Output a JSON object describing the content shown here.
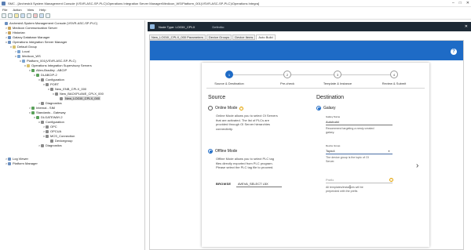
{
  "window": {
    "title": "SMC - [ArchestrA System Management Console (VSVR-ASC-SP-PLC)\\Operations Integration Server Manager\\Medicon_WS\\Platform_001(VSVR-ASC-SP-PLC)\\Operations Integra]"
  },
  "menu": [
    "File",
    "Action",
    "View",
    "Help"
  ],
  "tree": [
    {
      "label": "ArchestrA System Management Console (VSVR-ASC-SP-PLC)",
      "toggle": ""
    },
    {
      "label": "Medicon Communication Server",
      "toggle": ">"
    },
    {
      "label": "Historian",
      "toggle": ">"
    },
    {
      "label": "Galaxy Database Manager",
      "toggle": ">"
    },
    {
      "label": "Operations Integration Server Manager",
      "toggle": "v"
    },
    {
      "label": "Default Group",
      "toggle": "v"
    },
    {
      "label": "Local",
      "toggle": ">"
    },
    {
      "label": "Medicon_WS",
      "toggle": "v"
    },
    {
      "label": "Platform_001(VSVR-ASC-SP-PLC)",
      "toggle": "v"
    },
    {
      "label": "Operations Integration Supervisory Servers",
      "toggle": "v"
    },
    {
      "label": "Allen-Bradley - ABCIP",
      "toggle": "v"
    },
    {
      "label": "DLABCIP-2",
      "toggle": "v"
    },
    {
      "label": "Configuration",
      "toggle": "v"
    },
    {
      "label": "PORT",
      "toggle": "v"
    },
    {
      "label": "New_ENB_CPLX_000",
      "toggle": "v"
    },
    {
      "label": "New_BACKPLANE_CPLX_000",
      "toggle": "v"
    },
    {
      "label": "New_LOGIX_CPLX_000",
      "toggle": ""
    },
    {
      "label": "Diagnostics",
      "toggle": ">"
    },
    {
      "label": "Internal - SIM",
      "toggle": ">"
    },
    {
      "label": "Standards - Gateway",
      "toggle": "v"
    },
    {
      "label": "DLGATEWAY-2",
      "toggle": "v"
    },
    {
      "label": "Configuration",
      "toggle": "v"
    },
    {
      "label": "OPC",
      "toggle": ">"
    },
    {
      "label": "OPCUA",
      "toggle": ">"
    },
    {
      "label": "MCS_Connection",
      "toggle": "v"
    },
    {
      "label": "Devicegroup",
      "toggle": ""
    },
    {
      "label": "Diagnostics",
      "toggle": ">"
    },
    {
      "label": "Log Viewer",
      "toggle": ">"
    },
    {
      "label": "Platform Manager",
      "toggle": ">"
    }
  ],
  "object_header": {
    "node_type": "Node Type: LOGIX_CPLX",
    "definition": "Definitio:"
  },
  "tabs": [
    {
      "label": "New_LOGIX_CPLX_000 Parameters",
      "active": false
    },
    {
      "label": "Device Groups",
      "active": false
    },
    {
      "label": "Device Items",
      "active": false
    },
    {
      "label": "Auto Build",
      "active": true
    }
  ],
  "help_label": "?",
  "steps": [
    {
      "num": "1",
      "label": "Source & Destination",
      "active": true
    },
    {
      "num": "2",
      "label": "Pre-check",
      "active": false
    },
    {
      "num": "3",
      "label": "Template & Instance",
      "active": false
    },
    {
      "num": "4",
      "label": "Review & Submit",
      "active": false
    }
  ],
  "source": {
    "title": "Source",
    "online_label": "Online Mode",
    "online_desc": [
      "Online Mode allows you to select OI Servers",
      "that are activated. The list of PLCs are",
      "provided through OI Server hierarchies",
      "connectivity."
    ],
    "offline_label": "Offline Mode",
    "offline_desc": [
      "Offline Mode allows you to select PLC tag",
      "files directly exported from PLC program.",
      "Please select the PLC tag file to proceed."
    ],
    "browse_label": "BROWSE",
    "file_name": "AVEVA_SELECT L5X",
    "selected": "offline"
  },
  "destination": {
    "title": "Destination",
    "galaxy_label": "Galaxy",
    "galaxy_name_label": "Galaxy Name",
    "galaxy_name_value": "Autobuild",
    "galaxy_help": [
      "Recommend targeting a newly created",
      "galaxy."
    ],
    "device_group_label": "Device Group",
    "device_group_value": "Topic4",
    "device_group_help": [
      "The device group is the topic of OI",
      "Server."
    ],
    "prefix_placeholder": "Prefix",
    "prefix_help": [
      "All templates/instances will be",
      "prepended with the prefix."
    ]
  },
  "next_arrow": "›",
  "colors": {
    "accent": "#1e6bc6",
    "header_dark": "#1e2a36",
    "warning": "#e3a200"
  }
}
